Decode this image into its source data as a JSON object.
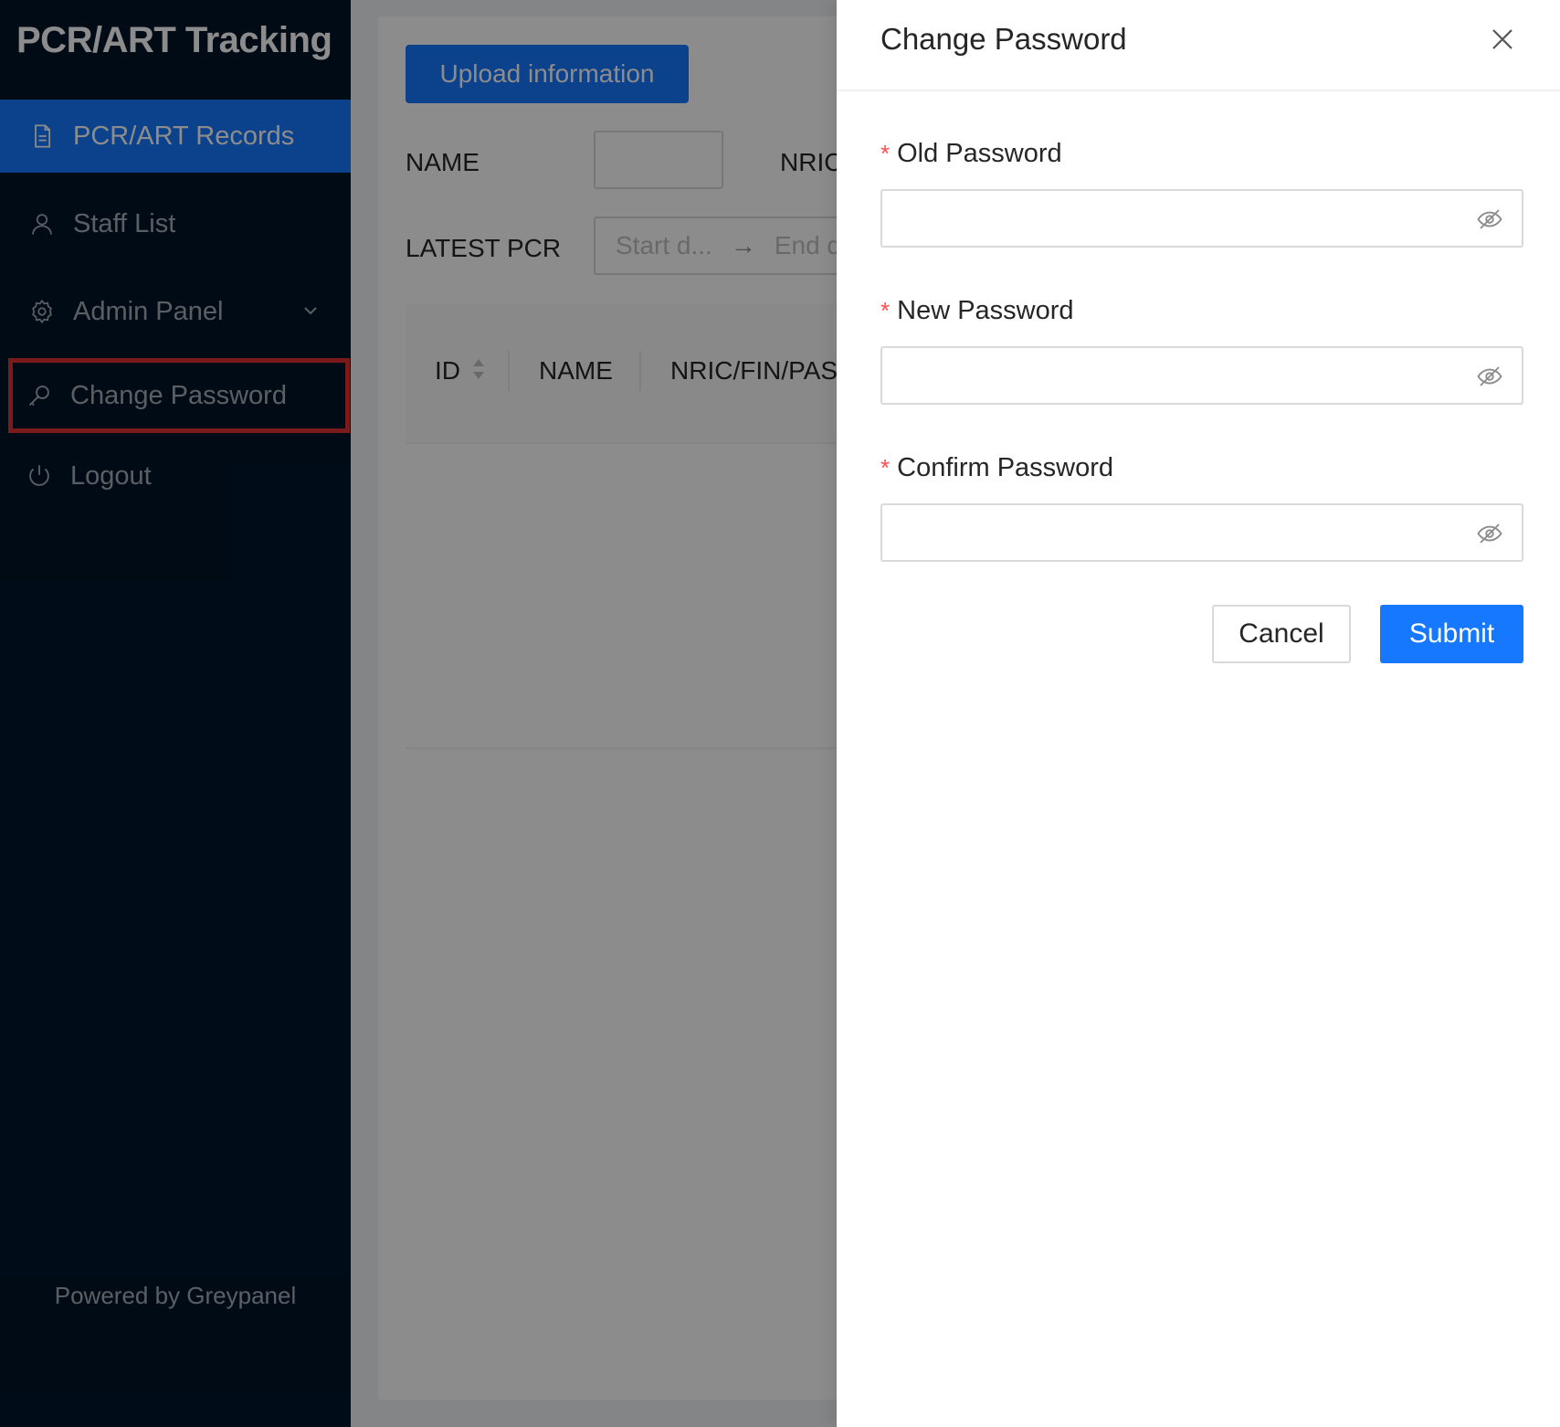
{
  "sidebar": {
    "app_title": "PCR/ART Tracking",
    "items": [
      {
        "label": "PCR/ART Records",
        "icon": "file-text-icon"
      },
      {
        "label": "Staff List",
        "icon": "user-icon"
      },
      {
        "label": "Admin Panel",
        "icon": "gear-icon"
      },
      {
        "label": "Change Password",
        "icon": "key-icon"
      },
      {
        "label": "Logout",
        "icon": "power-icon"
      }
    ],
    "footer": "Powered by Greypanel"
  },
  "content": {
    "upload_label": "Upload information",
    "filters": {
      "name_label": "NAME",
      "nric_label": "NRIC",
      "latest_pcr_label": "LATEST PCR",
      "start_placeholder": "Start d...",
      "end_placeholder": "End d"
    },
    "table": {
      "columns": [
        "ID",
        "NAME",
        "NRIC/FIN/PAS"
      ]
    }
  },
  "drawer": {
    "title": "Change Password",
    "fields": [
      {
        "label": "Old Password",
        "value": ""
      },
      {
        "label": "New Password",
        "value": ""
      },
      {
        "label": "Confirm Password",
        "value": ""
      }
    ],
    "cancel_label": "Cancel",
    "submit_label": "Submit"
  },
  "colors": {
    "sider_bg": "#001529",
    "primary": "#1677ff",
    "required": "#ff4d4f",
    "highlight": "#e03131"
  }
}
